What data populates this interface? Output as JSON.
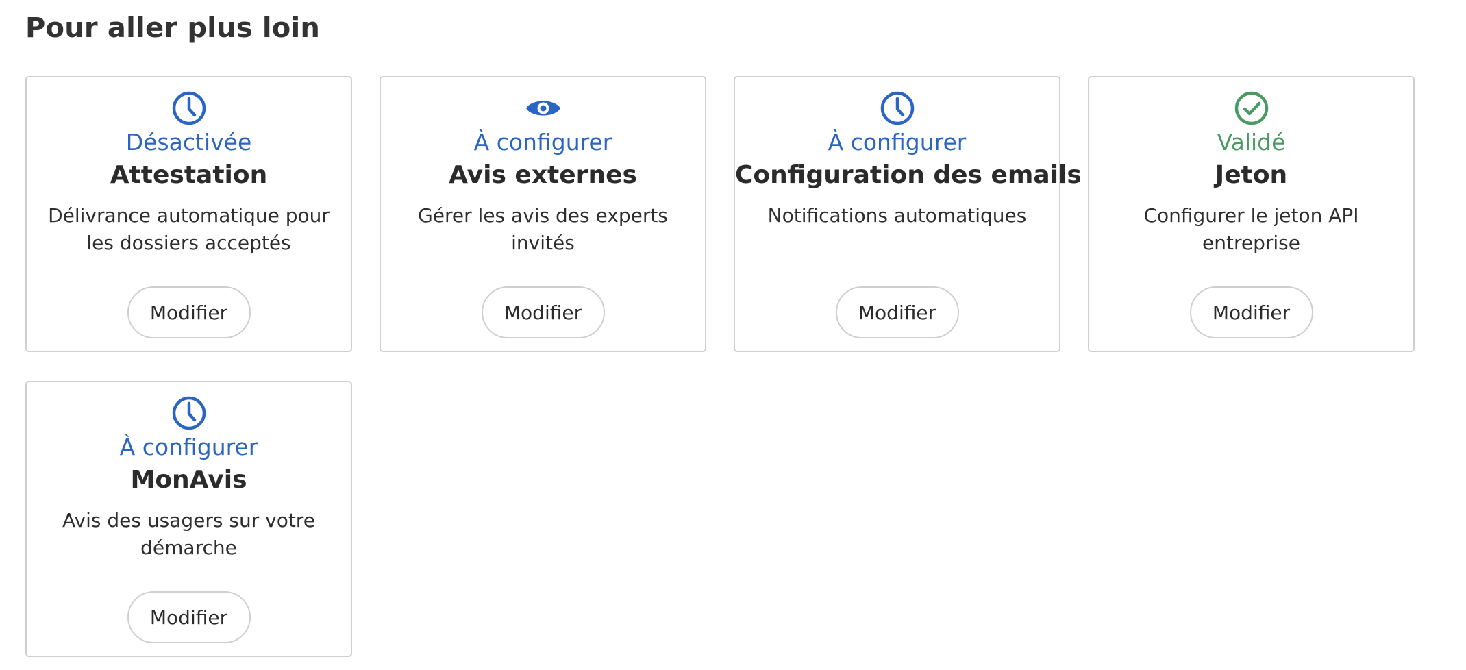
{
  "page": {
    "title": "Pour aller plus loin"
  },
  "colors": {
    "pending": "#2b65c4",
    "valid": "#4a9a63"
  },
  "cards": [
    {
      "status": "Désactivée",
      "status_color": "#2b65c4",
      "icon": "clock-icon",
      "title": "Attestation",
      "description": "Délivrance automatique pour les dossiers acceptés",
      "button": "Modifier"
    },
    {
      "status": "À configurer",
      "status_color": "#2b65c4",
      "icon": "eye-icon",
      "title": "Avis externes",
      "description": "Gérer les avis des experts invités",
      "button": "Modifier"
    },
    {
      "status": "À configurer",
      "status_color": "#2b65c4",
      "icon": "clock-icon",
      "title": "Configuration des emails",
      "description": "Notifications automatiques",
      "button": "Modifier"
    },
    {
      "status": "Validé",
      "status_color": "#4a9a63",
      "icon": "check-circle-icon",
      "title": "Jeton",
      "description": "Configurer le jeton API entreprise",
      "button": "Modifier"
    },
    {
      "status": "À configurer",
      "status_color": "#2b65c4",
      "icon": "clock-icon",
      "title": "MonAvis",
      "description": "Avis des usagers sur votre démarche",
      "button": "Modifier"
    }
  ]
}
